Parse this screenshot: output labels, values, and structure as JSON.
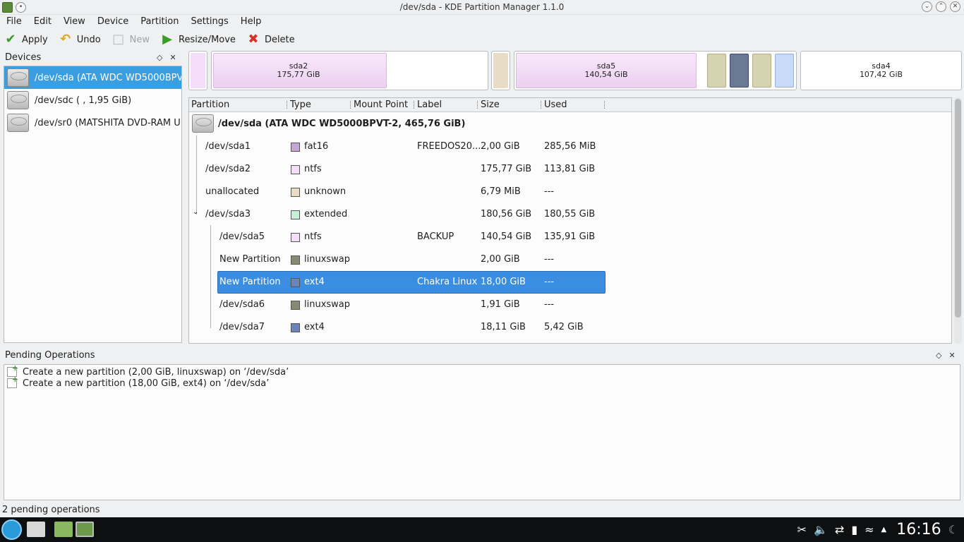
{
  "window": {
    "title": "/dev/sda - KDE Partition Manager 1.1.0"
  },
  "menu": [
    "File",
    "Edit",
    "View",
    "Device",
    "Partition",
    "Settings",
    "Help"
  ],
  "toolbar": {
    "apply": "Apply",
    "undo": "Undo",
    "new": "New",
    "resize": "Resize/Move",
    "delete": "Delete"
  },
  "devices": {
    "title": "Devices",
    "items": [
      "/dev/sda (ATA WDC WD5000BPV...",
      "/dev/sdc ( , 1,95 GiB)",
      "/dev/sr0 (MATSHITA DVD-RAM U..."
    ]
  },
  "partition_bar": {
    "sda2_name": "sda2",
    "sda2_size": "175,77 GiB",
    "sda5_name": "sda5",
    "sda5_size": "140,54 GiB",
    "sda4_name": "sda4",
    "sda4_size": "107,42 GiB"
  },
  "table": {
    "headers": [
      "Partition",
      "Type",
      "Mount Point",
      "Label",
      "Size",
      "Used"
    ],
    "device_row": "/dev/sda (ATA WDC WD5000BPVT-2, 465,76 GiB)",
    "rows": [
      {
        "partition": "/dev/sda1",
        "type": "fat16",
        "label": "FREEDOS20...",
        "size": "2,00 GiB",
        "used": "285,56 MiB",
        "color": "#c6a6d6"
      },
      {
        "partition": "/dev/sda2",
        "type": "ntfs",
        "label": "",
        "size": "175,77 GiB",
        "used": "113,81 GiB",
        "color": "#f4ddf7"
      },
      {
        "partition": "unallocated",
        "type": "unknown",
        "label": "",
        "size": "6,79 MiB",
        "used": "---",
        "color": "#e8dcc6"
      },
      {
        "partition": "/dev/sda3",
        "type": "extended",
        "label": "",
        "size": "180,56 GiB",
        "used": "180,55 GiB",
        "color": "#c6f0d6"
      },
      {
        "partition": "/dev/sda5",
        "type": "ntfs",
        "label": "BACKUP",
        "size": "140,54 GiB",
        "used": "135,91 GiB",
        "color": "#f4ddf7"
      },
      {
        "partition": "New Partition",
        "type": "linuxswap",
        "label": "",
        "size": "2,00 GiB",
        "used": "---",
        "color": "#8a8a72"
      },
      {
        "partition": "New Partition",
        "type": "ext4",
        "label": "Chakra Linux",
        "size": "18,00 GiB",
        "used": "---",
        "color": "#6a86b8"
      },
      {
        "partition": "/dev/sda6",
        "type": "linuxswap",
        "label": "",
        "size": "1,91 GiB",
        "used": "---",
        "color": "#8a8a72"
      },
      {
        "partition": "/dev/sda7",
        "type": "ext4",
        "label": "",
        "size": "18,11 GiB",
        "used": "5,42 GiB",
        "color": "#6a86b8"
      }
    ]
  },
  "pending": {
    "title": "Pending Operations",
    "ops": [
      "Create a new partition (2,00 GiB, linuxswap) on ‘/dev/sda’",
      "Create a new partition (18,00 GiB, ext4) on ‘/dev/sda’"
    ]
  },
  "status": "2 pending operations",
  "taskbar": {
    "clock": "16:16"
  }
}
